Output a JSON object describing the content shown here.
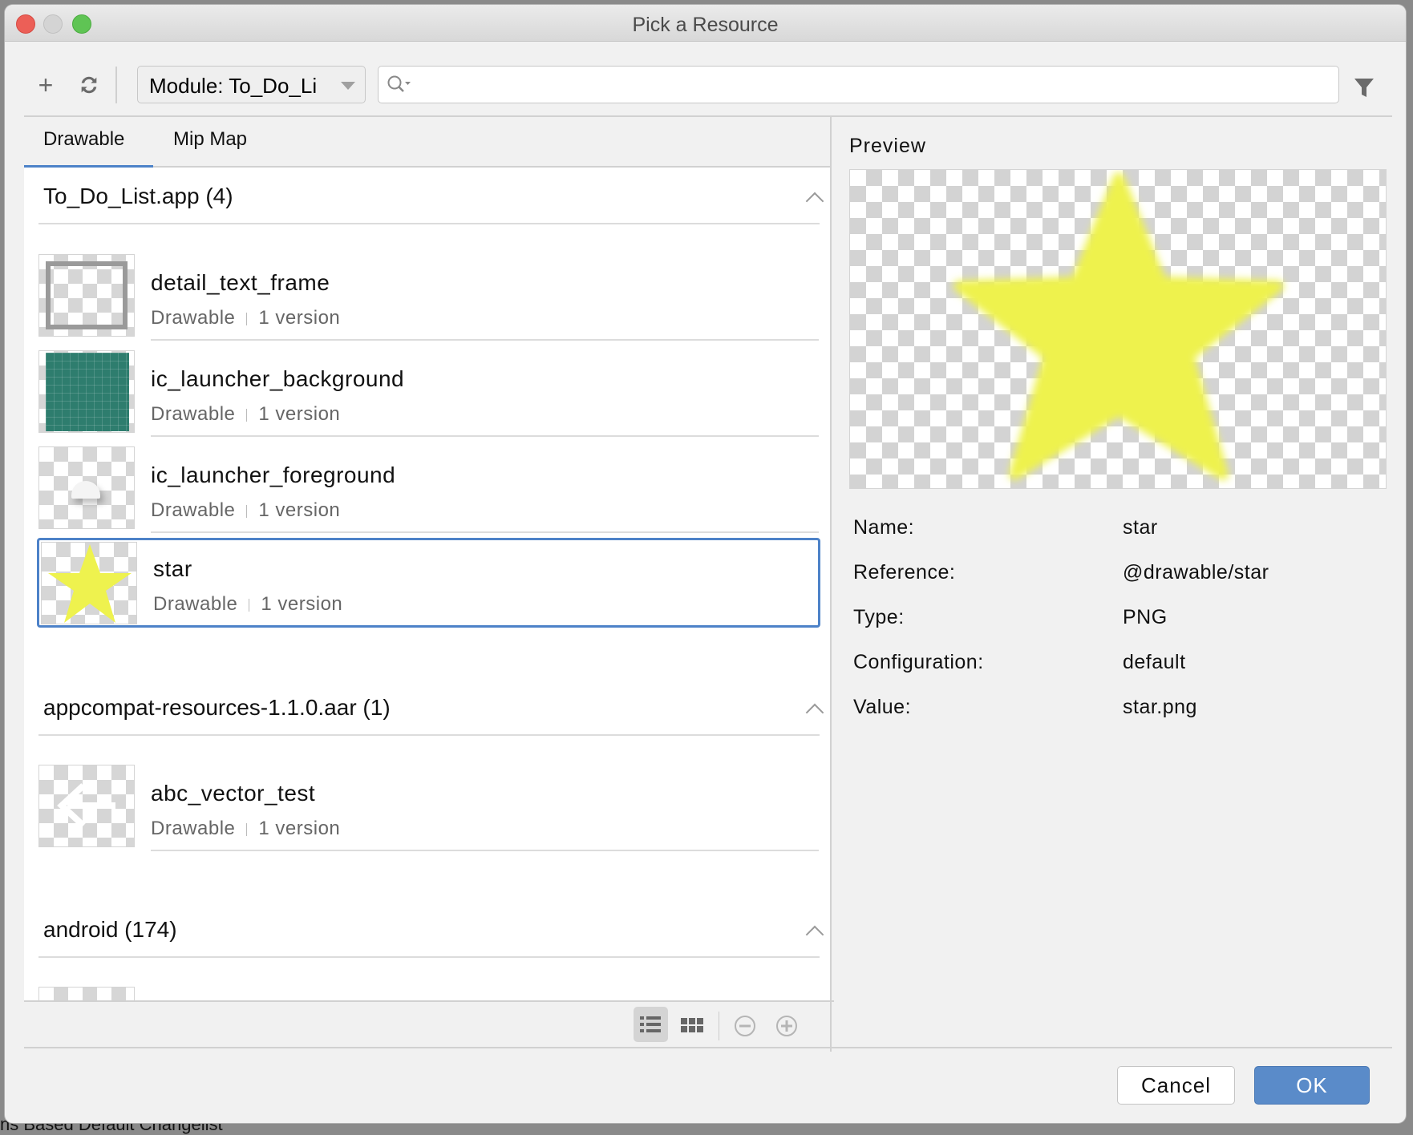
{
  "background": {
    "status_text": "ns Based      Default Changelist"
  },
  "window": {
    "title": "Pick a Resource"
  },
  "toolbar": {
    "module_label": "Module: To_Do_Li",
    "search_value": "",
    "search_placeholder": ""
  },
  "tabs": [
    {
      "label": "Drawable",
      "active": true
    },
    {
      "label": "Mip Map",
      "active": false
    }
  ],
  "groups": [
    {
      "title": "To_Do_List.app (4)",
      "items": [
        {
          "name": "detail_text_frame",
          "type": "Drawable",
          "versions": "1 version"
        },
        {
          "name": "ic_launcher_background",
          "type": "Drawable",
          "versions": "1 version"
        },
        {
          "name": "ic_launcher_foreground",
          "type": "Drawable",
          "versions": "1 version"
        },
        {
          "name": "star",
          "type": "Drawable",
          "versions": "1 version",
          "selected": true
        }
      ]
    },
    {
      "title": "appcompat-resources-1.1.0.aar (1)",
      "items": [
        {
          "name": "abc_vector_test",
          "type": "Drawable",
          "versions": "1 version"
        }
      ]
    },
    {
      "title": "android (174)",
      "items": []
    }
  ],
  "preview": {
    "title": "Preview",
    "details": [
      {
        "label": "Name:",
        "value": "star"
      },
      {
        "label": "Reference:",
        "value": "@drawable/star"
      },
      {
        "label": "Type:",
        "value": "PNG"
      },
      {
        "label": "Configuration:",
        "value": "default"
      },
      {
        "label": "Value:",
        "value": "star.png"
      }
    ]
  },
  "buttons": {
    "cancel": "Cancel",
    "ok": "OK"
  },
  "colors": {
    "accent": "#4d82c8",
    "ok_button": "#5a8bc9",
    "star": "#eef24e",
    "launcher_bg": "#2e7d6e"
  }
}
